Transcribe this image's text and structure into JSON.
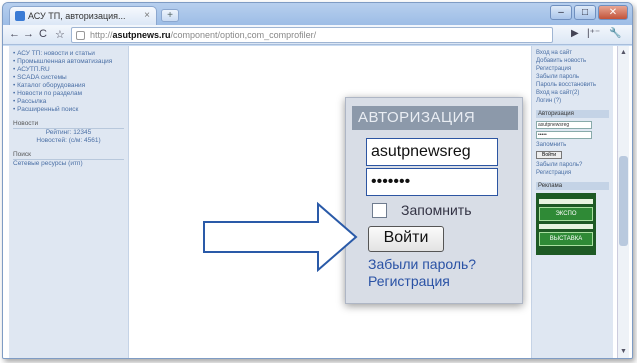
{
  "browser": {
    "tab_title": "АСУ ТП, авторизация...",
    "tab_close": "×",
    "new_tab": "+",
    "window_buttons": {
      "minimize": "–",
      "maximize": "□",
      "close": "✕"
    },
    "nav": {
      "back": "←",
      "forward": "→",
      "reload": "C",
      "star": "☆"
    },
    "url_prefix": "http://",
    "url_domain": "asutpnews.ru",
    "url_path": "/component/option,com_comprofiler/",
    "toolbar_right": {
      "go": "▶",
      "page_menu": "|⁺⁻",
      "tools": "🔧"
    }
  },
  "left_sidebar": {
    "links": [
      "• АСУ ТП: новости и статьи",
      "• Промышленная автоматизация",
      "• АСУТП.RU",
      "• SCADA системы",
      "• Каталог оборудования",
      "• Новости по разделам",
      "• Рассылка",
      "• Расширенный поиск"
    ],
    "headers": [
      "Новости",
      "Поиск"
    ],
    "stats": [
      "Рейтинг: 12345",
      "Новостей: (c/м: 4561)"
    ],
    "search_link": "Сетевые ресурсы (итп)"
  },
  "login": {
    "title": "АВТОРИЗАЦИЯ",
    "username_value": "asutpnewsreg",
    "password_value": "•••••••",
    "remember_label": "Запомнить",
    "submit_label": "Войти",
    "forgot_label": "Забыли пароль?",
    "register_label": "Регистрация"
  },
  "right_sidebar": {
    "links": [
      "Вход на сайт",
      "Добавить новость",
      "Регистрация",
      "Забыли пароль",
      "Пароль восстановить",
      "Вход на сайт(2)",
      "Логин (?)"
    ],
    "header_auth": "Авторизация",
    "mini_user": "asutpnewsreg",
    "mini_pass": "•••••",
    "mini_remember": "Запомнить",
    "mini_btn": "Войти",
    "mini_forgot": "Забыли пароль?",
    "mini_register": "Регистрация",
    "header_banner": "Реклама",
    "banner_logo": "ЭКСПО",
    "banner_text": "ВЫСТАВКА"
  },
  "scrollbar": {
    "up": "▲",
    "down": "▼"
  },
  "colors": {
    "frame": "#c9dcf2",
    "panel": "#d8dde6",
    "title_bar": "#8c99aa",
    "link": "#2a52a5"
  }
}
